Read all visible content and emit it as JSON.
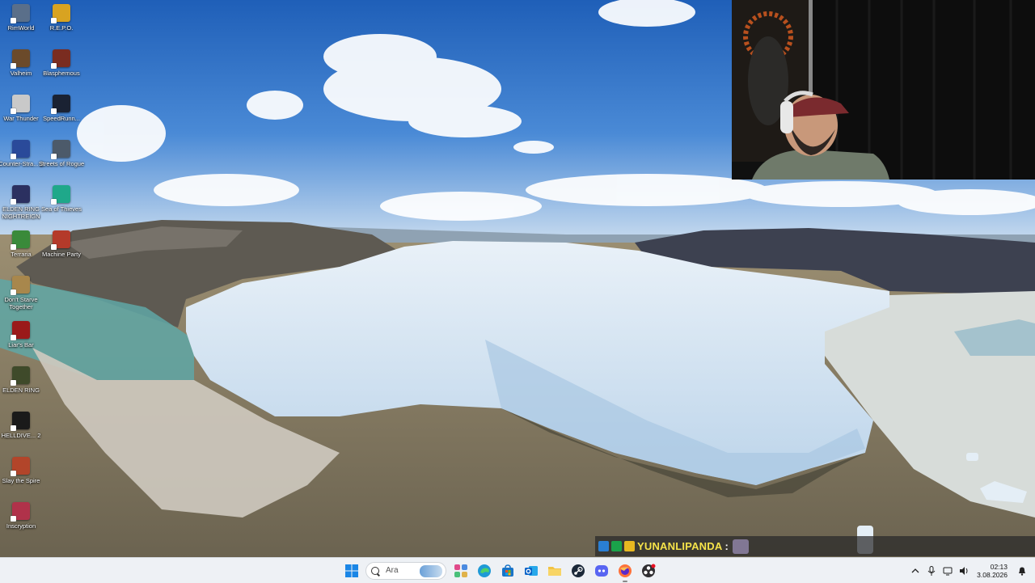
{
  "desktop": {
    "icons": [
      {
        "label": "RimWorld",
        "icon": "rimworld-icon",
        "color": "#5a6f8a"
      },
      {
        "label": "R.E.P.O.",
        "icon": "repo-icon",
        "color": "#d8a321"
      },
      {
        "label": "Valheim",
        "icon": "valheim-icon",
        "color": "#6b4a2a"
      },
      {
        "label": "Blasphemous",
        "icon": "blasphemous-icon",
        "color": "#7a2c20"
      },
      {
        "label": "War Thunder",
        "icon": "war-thunder-icon",
        "color": "#c9c9c9"
      },
      {
        "label": "SpeedRunn...",
        "icon": "speedrunners-icon",
        "color": "#1a2233"
      },
      {
        "label": "Counter-Stra... 2",
        "icon": "counter-strike-icon",
        "color": "#2a4a9a"
      },
      {
        "label": "Streets of Rogue",
        "icon": "streets-of-rogue-icon",
        "color": "#4c5a6a"
      },
      {
        "label": "ELDEN RING NIGHTREIGN",
        "icon": "elden-ring-nightreign-icon",
        "color": "#2b3060"
      },
      {
        "label": "Sea of Thieves",
        "icon": "sea-of-thieves-icon",
        "color": "#1fa88a"
      },
      {
        "label": "Terraria",
        "icon": "terraria-icon",
        "color": "#3a8a3a"
      },
      {
        "label": "Machine Party",
        "icon": "machine-party-icon",
        "color": "#b43a2a"
      },
      {
        "label": "Don't Starve Together",
        "icon": "dont-starve-together-icon",
        "color": "#a8874c"
      },
      {
        "label": "Liar's Bar",
        "icon": "liars-bar-icon",
        "color": "#9a1a1a"
      },
      {
        "label": "ELDEN RING",
        "icon": "elden-ring-icon",
        "color": "#3f4a2a"
      },
      {
        "label": "HELLDIVE... 2",
        "icon": "helldivers-2-icon",
        "color": "#1a1a1a"
      },
      {
        "label": "Slay the Spire",
        "icon": "slay-the-spire-icon",
        "color": "#b2452a"
      },
      {
        "label": "Inscryption",
        "icon": "inscryption-icon",
        "color": "#b0324a"
      }
    ]
  },
  "chat": {
    "username": "YUNANLIPANDA",
    "separator": ":",
    "badge_colors": [
      "#2a7fd4",
      "#1aa34a",
      "#e8b820"
    ]
  },
  "taskbar": {
    "search_placeholder": "Ara",
    "apps": [
      {
        "name": "start-button",
        "icon": "windows-icon"
      },
      {
        "name": "widgets-button",
        "icon": "widgets-icon"
      },
      {
        "name": "edge-button",
        "icon": "edge-icon"
      },
      {
        "name": "store-button",
        "icon": "store-icon"
      },
      {
        "name": "outlook-button",
        "icon": "outlook-icon"
      },
      {
        "name": "file-explorer-button",
        "icon": "folder-icon"
      },
      {
        "name": "steam-button",
        "icon": "steam-icon"
      },
      {
        "name": "discord-button",
        "icon": "discord-icon"
      },
      {
        "name": "firefox-button",
        "icon": "firefox-icon"
      },
      {
        "name": "obs-button",
        "icon": "obs-icon"
      }
    ],
    "time": "02:13",
    "date": "3.08.2026"
  }
}
